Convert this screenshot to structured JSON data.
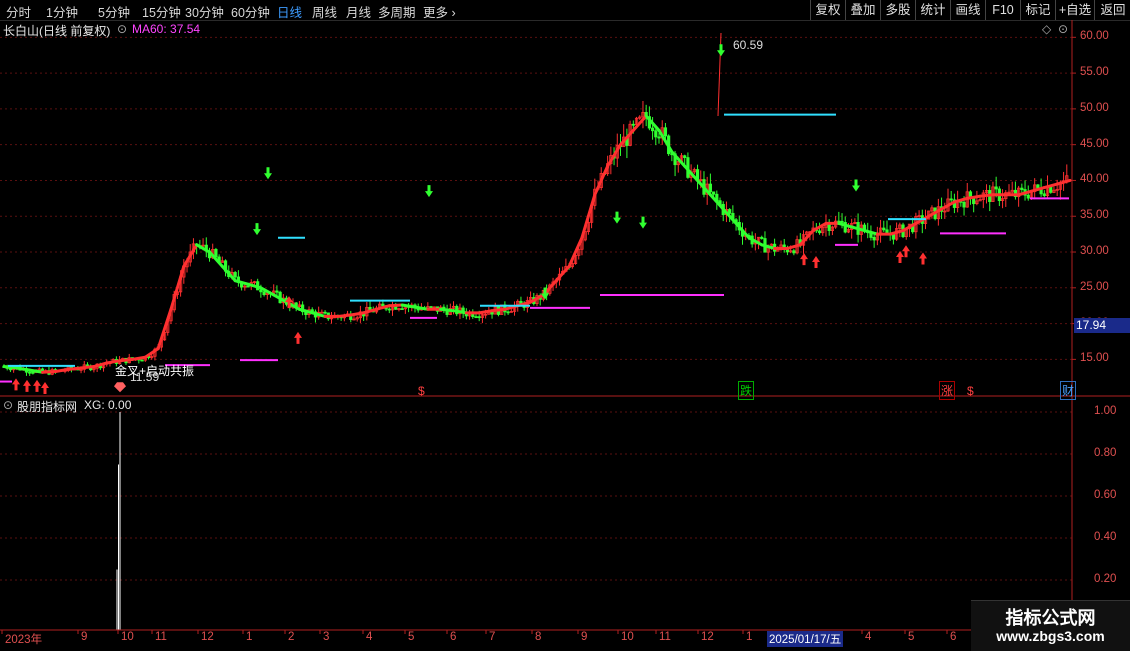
{
  "toolbar": {
    "periods": [
      {
        "label": "分时",
        "active": false
      },
      {
        "label": "1分钟",
        "active": false
      },
      {
        "label": "5分钟",
        "active": false
      },
      {
        "label": "15分钟",
        "active": false
      },
      {
        "label": "30分钟",
        "active": false
      },
      {
        "label": "60分钟",
        "active": false
      },
      {
        "label": "日线",
        "active": true
      },
      {
        "label": "周线",
        "active": false
      },
      {
        "label": "月线",
        "active": false
      },
      {
        "label": "多周期",
        "active": false
      }
    ],
    "more_label": "更多",
    "more_icon": "chevron-right-icon",
    "right_buttons": [
      "复权",
      "叠加",
      "多股",
      "统计",
      "画线",
      "F10",
      "标记",
      "+自选",
      "返回"
    ]
  },
  "main_panel": {
    "stock_title": "长白山(日线 前复权)",
    "ma_label": "MA60: 37.54",
    "ma_color": "#ff44ff",
    "price_axis": [
      "60.00",
      "55.00",
      "50.00",
      "45.00",
      "40.00",
      "35.00",
      "30.00",
      "25.00",
      "20.00",
      "15.00"
    ],
    "current_price": "17.94",
    "high_label": "60.59",
    "low_label": "11.59",
    "signal_text": "金叉+启动共振",
    "markers": [
      {
        "label": "$",
        "color": "#ff4040"
      },
      {
        "label": "跌",
        "color": "#00cc00"
      },
      {
        "label": "涨",
        "color": "#ff4040"
      },
      {
        "label": "$",
        "color": "#ff4040"
      },
      {
        "label": "财",
        "color": "#4aa0ff"
      }
    ]
  },
  "indicator_panel": {
    "title": "股朋指标网",
    "value_label": "XG: 0.00",
    "axis": [
      "1.00",
      "0.80",
      "0.60",
      "0.40",
      "0.20"
    ]
  },
  "x_axis": {
    "labels": [
      "2023年",
      "9",
      "10",
      "11",
      "12",
      "1",
      "2",
      "3",
      "4",
      "5",
      "6",
      "7",
      "8",
      "9",
      "10",
      "11",
      "12",
      "1"
    ],
    "cursor_date": "2025/01/17/五",
    "labels_after_cursor": [
      "4",
      "5",
      "6"
    ]
  },
  "watermark": {
    "line1": "指标公式网",
    "line2": "www.zbgs3.com"
  },
  "colors": {
    "up": "#ff3030",
    "down": "#30ff30",
    "axis": "#b02020",
    "grid": "#5a1010",
    "cyan": "#30e0ff",
    "magenta": "#ff30ff",
    "yellow": "#ffff00"
  },
  "chart_data": {
    "type": "line",
    "ylim": [
      11,
      62
    ],
    "x_labels": [
      "2023年",
      "9",
      "10",
      "11",
      "12",
      "1",
      "2",
      "3",
      "4",
      "5",
      "6",
      "7",
      "8",
      "9",
      "10",
      "11",
      "12",
      "1",
      "4",
      "5",
      "6"
    ],
    "series": [
      {
        "values": [
          14,
          13.8,
          13.5,
          13.2,
          13.3,
          13.6,
          13.8,
          14,
          14.5,
          14.8,
          15,
          15.3,
          16.5,
          22,
          28,
          31,
          30,
          28,
          26,
          25.5,
          25,
          24,
          23,
          22,
          21.5,
          21,
          21,
          21.2,
          21.5,
          22,
          22.5,
          22.6,
          22.3,
          22,
          22,
          21.8,
          21.5,
          21.5,
          21.8,
          22,
          22.5,
          23,
          24,
          26,
          28,
          32,
          38,
          42,
          45,
          47,
          49,
          47,
          44,
          42,
          40,
          38,
          36,
          34,
          32,
          31,
          30.5,
          30.5,
          31,
          33,
          34,
          34,
          33.5,
          33,
          32.5,
          32.5,
          33,
          34,
          35,
          36,
          37,
          37.5,
          37.8,
          38,
          38,
          38,
          38.5,
          39,
          39.5,
          40
        ]
      },
      {
        "values": [
          0.0,
          1.0
        ]
      }
    ],
    "indicator_spike": {
      "x_label": "10",
      "value": 1.0
    }
  }
}
